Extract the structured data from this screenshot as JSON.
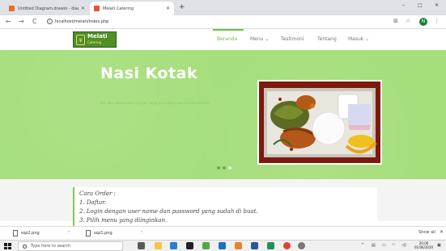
{
  "browser": {
    "tabs": [
      {
        "title": "Untitled Diagram.drawio - diagr...",
        "active": false
      },
      {
        "title": "Melati Catering",
        "active": true
      }
    ],
    "new_tab": "+",
    "window_controls": [
      "–",
      "□",
      "✕"
    ],
    "back": "←",
    "forward": "→",
    "reload": "C",
    "info": "i",
    "url": "localhost/melati/index.php",
    "profile_initial": "N"
  },
  "site": {
    "logo": {
      "name": "Melati",
      "tagline": "Catering"
    },
    "menu": [
      {
        "label": "Beranda",
        "active": true
      },
      {
        "label": "Menu ⌄",
        "active": false
      },
      {
        "label": "Testimoni",
        "active": false
      },
      {
        "label": "Tentang",
        "active": false
      },
      {
        "label": "Masuk ⌄",
        "active": false
      }
    ],
    "hero": {
      "title": "Nasi Kotak",
      "subtitle": "Kini Nasi Kotak hadir dengan harga terjangkau dan kualitas terbaik.",
      "active_slide": 3,
      "slide_count": 3
    },
    "order": {
      "lines": [
        "Cara Order :",
        "1. Daftar.",
        "2. Login dengan user name dan password yang sudah di buat.",
        "3. Pilih menu yang diinginkan."
      ]
    }
  },
  "downloads": {
    "items": [
      {
        "name": "sqz2.png"
      },
      {
        "name": "sqz1.png"
      }
    ],
    "show_all": "Show all",
    "close": "✕"
  },
  "taskbar": {
    "search_placeholder": "Type here to search",
    "time": "20:06",
    "date": "01/06/2020"
  },
  "colors": {
    "brand_green": "#6cbf47",
    "hero_bg": "#a6de7c",
    "logo_bg": "#4f8f26"
  }
}
